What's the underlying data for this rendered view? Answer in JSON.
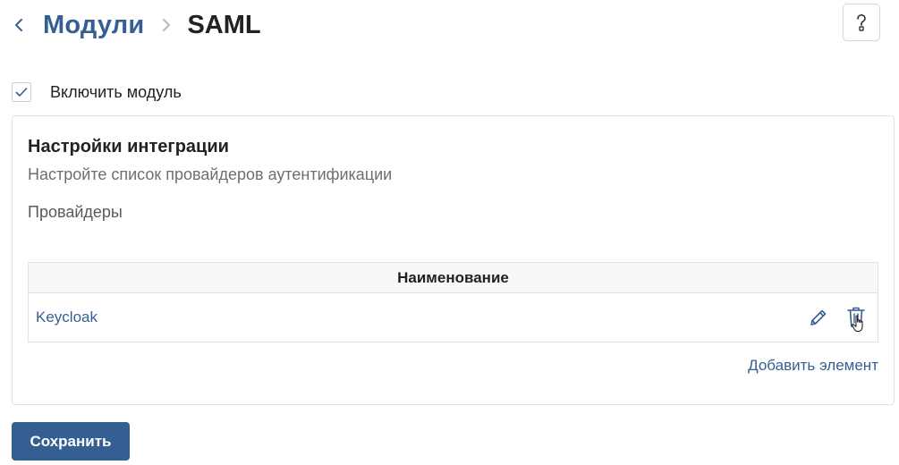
{
  "header": {
    "back_icon": "chevron-left-icon",
    "breadcrumb_parent": "Модули",
    "breadcrumb_separator_icon": "chevron-right-icon",
    "breadcrumb_current": "SAML",
    "help_icon": "question-mark-icon"
  },
  "module_toggle": {
    "checked": true,
    "label": "Включить модуль"
  },
  "integration": {
    "title": "Настройки интеграции",
    "subtitle": "Настройте список провайдеров аутентификации",
    "providers_label": "Провайдеры",
    "table": {
      "columns": [
        "Наименование"
      ],
      "rows": [
        {
          "name": "Keycloak"
        }
      ]
    },
    "add_item_label": "Добавить элемент"
  },
  "actions": {
    "save_label": "Сохранить"
  },
  "colors": {
    "accent": "#355f93",
    "text": "#222222",
    "muted": "#6b6f75",
    "border": "#dfe2e6"
  }
}
